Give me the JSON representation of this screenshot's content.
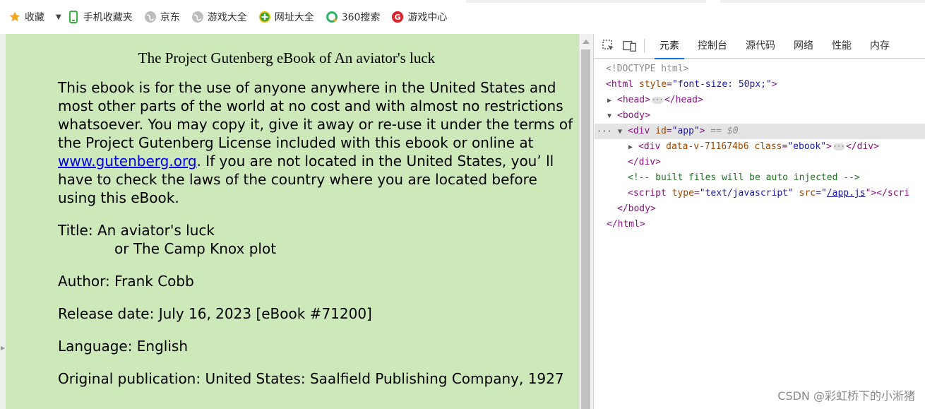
{
  "bookmarks": {
    "items": [
      {
        "label": "收藏",
        "icon": "star-icon"
      },
      {
        "label": "手机收藏夹",
        "icon": "phone-icon"
      },
      {
        "label": "京东",
        "icon": "globe-icon"
      },
      {
        "label": "游戏大全",
        "icon": "globe-icon"
      },
      {
        "label": "网址大全",
        "icon": "plus-circle-icon"
      },
      {
        "label": "360搜索",
        "icon": "search-360-icon"
      },
      {
        "label": "游戏中心",
        "icon": "game-center-icon"
      }
    ],
    "colors": {
      "star": "#f5a623",
      "phone": "#3cb043",
      "globe": "#9e9e9e",
      "plus": "#2e9f2e",
      "search360": "#2fb36a",
      "game": "#d9232d"
    }
  },
  "page": {
    "background": "#cde8b9",
    "title": "The Project Gutenberg eBook of An aviator's luck",
    "intro_before_link": "This ebook is for the use of anyone anywhere in the United States and most other parts of the world at no cost and with almost no restrictions whatsoever. You may copy it, give it away or re-use it under the terms of the Project Gutenberg License included with this ebook or online at ",
    "link_text": "www.gutenberg.org",
    "intro_after_link": ". If you are not located in the United States, you’ ll have to check the laws of the country where you are located before using this eBook.",
    "title_line1": "Title: An aviator's luck",
    "title_line2": "or The Camp Knox plot",
    "author": "Author: Frank Cobb",
    "release": "Release date: July 16, 2023 [eBook #71200]",
    "language": "Language: English",
    "publication": "Original publication: United States: Saalfield Publishing Company, 1927"
  },
  "devtools": {
    "tabs": [
      "元素",
      "控制台",
      "源代码",
      "网络",
      "性能",
      "内存"
    ],
    "active_tab": "元素",
    "tree": {
      "doctype": "<!DOCTYPE html>",
      "html_open_tag": "<html",
      "html_attr": "style",
      "html_attr_val": "\"font-size: 50px;\"",
      "html_close_bracket": ">",
      "head_open": "<head>",
      "head_close": "</head>",
      "body_open": "<body>",
      "div_open": "<div",
      "div_attr": "id",
      "div_attr_val": "\"app\"",
      "div_close_bracket": ">",
      "selected_marker": "== $0",
      "inner_div_open": "<div",
      "inner_div_attr1": "data-v-711674b6",
      "inner_div_attr2": "class",
      "inner_div_attr2_val": "\"ebook\"",
      "inner_div_close_bracket": ">",
      "inner_div_close": "</div>",
      "div_close": "</div>",
      "comment": "<!-- built files will be auto injected -->",
      "script_open": "<script",
      "script_attr1": "type",
      "script_attr1_val": "\"text/javascript\"",
      "script_attr2": "src",
      "script_attr2_val_q1": "=\"",
      "script_src": "/app.js",
      "script_tail": "\"></scri",
      "body_close": "</body>",
      "html_close": "</html>"
    }
  },
  "watermark": "CSDN @彩虹桥下的小淅猪"
}
